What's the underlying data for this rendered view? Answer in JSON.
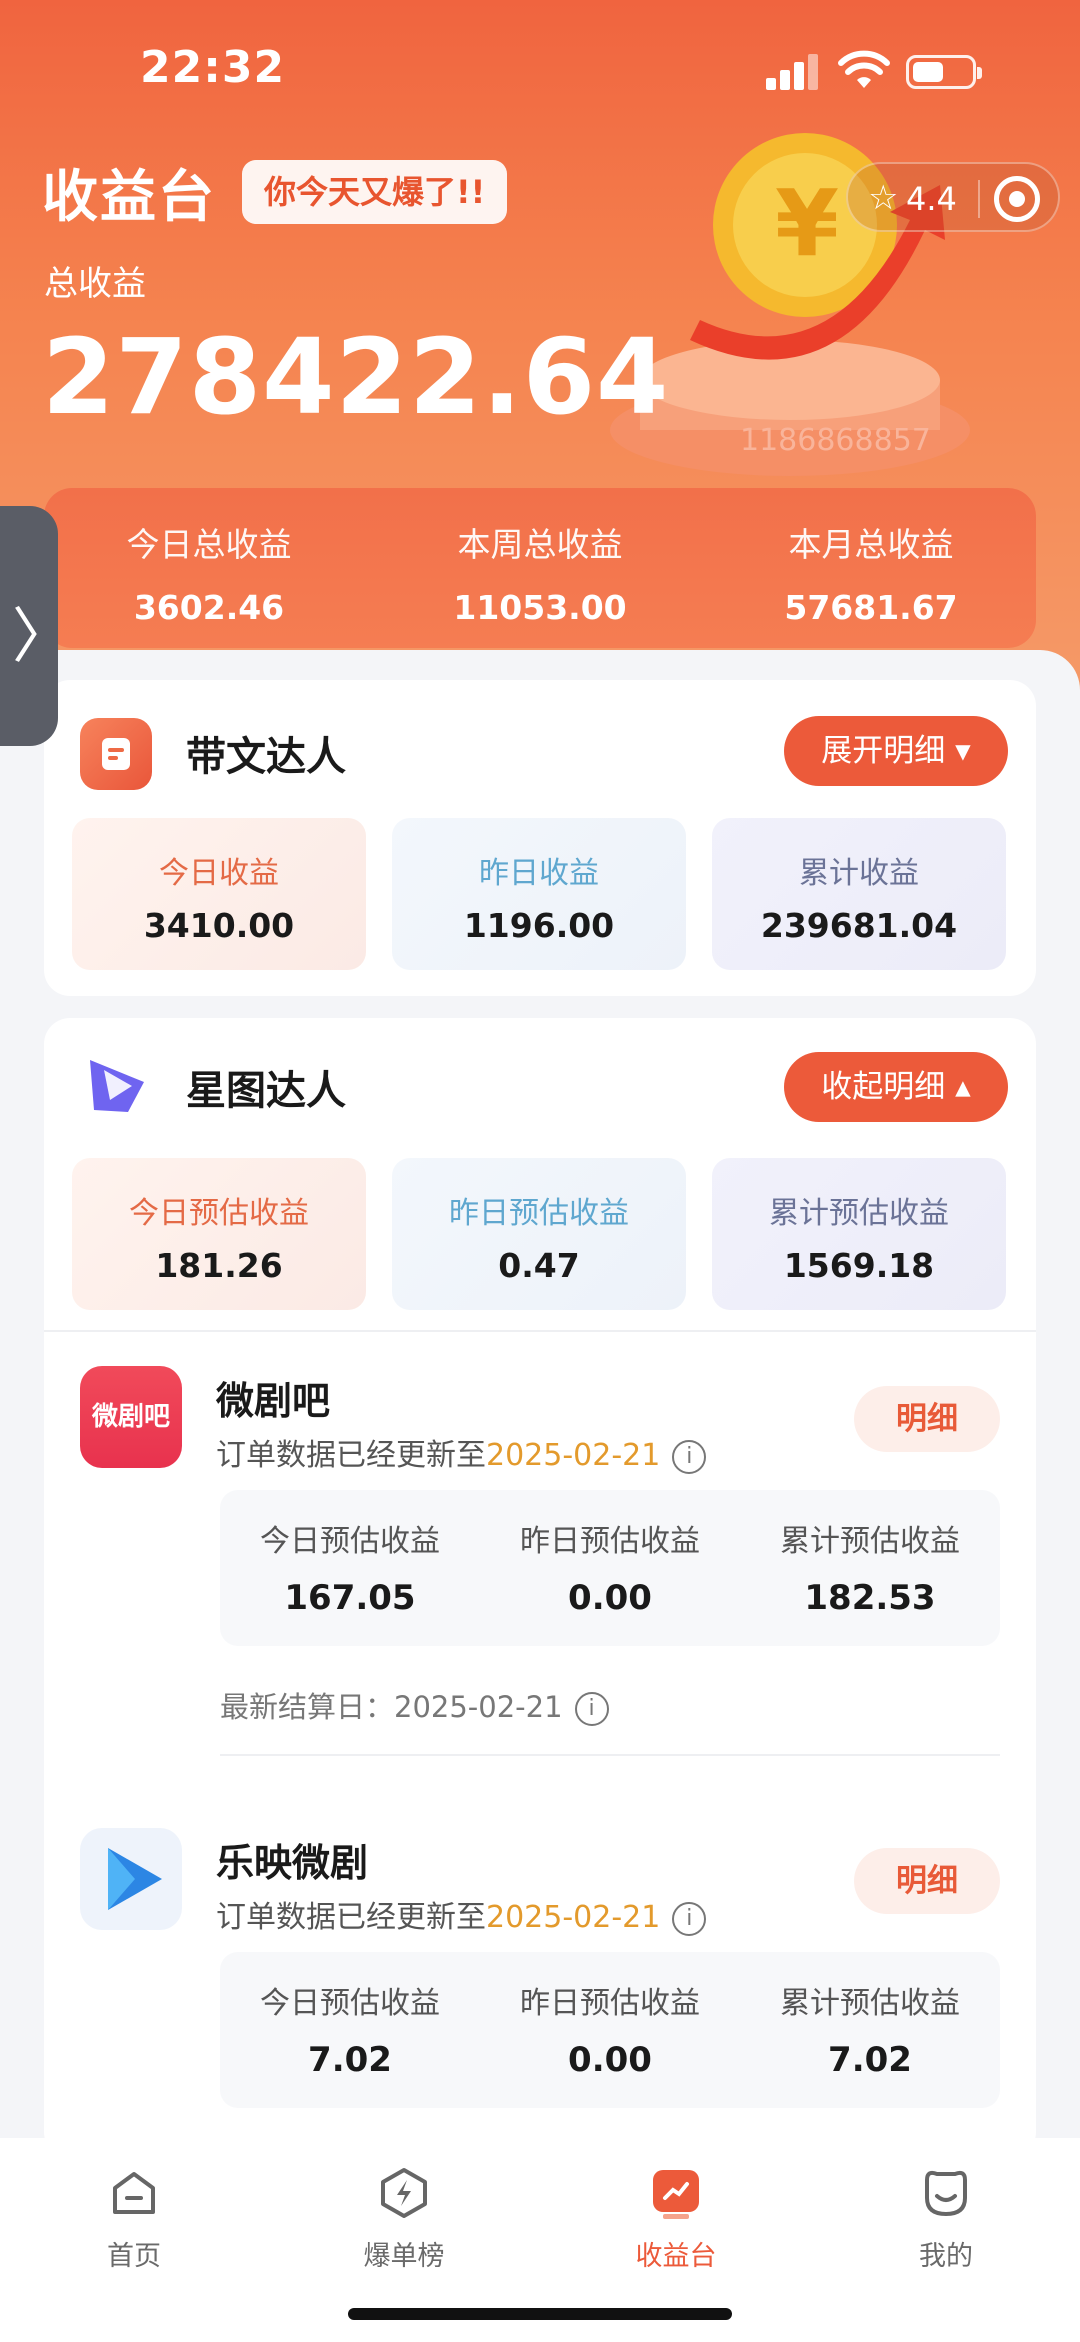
{
  "status_bar": {
    "time": "22:32"
  },
  "header": {
    "title": "收益台",
    "badge": "你今天又爆了!!",
    "rating": "4.4",
    "total_label": "总收益",
    "total_value": "278422.64",
    "coin_text": "1186868857"
  },
  "summary": [
    {
      "label": "今日总收益",
      "value": "3602.46"
    },
    {
      "label": "本周总收益",
      "value": "11053.00"
    },
    {
      "label": "本月总收益",
      "value": "57681.67"
    }
  ],
  "side_handle": {
    "glyph": "〉"
  },
  "card_daiwen": {
    "title": "带文达人",
    "button": "展开明细 ▾",
    "tiles": [
      {
        "label": "今日收益",
        "value": "3410.00"
      },
      {
        "label": "昨日收益",
        "value": "1196.00"
      },
      {
        "label": "累计收益",
        "value": "239681.04"
      }
    ]
  },
  "card_xingtu": {
    "title": "星图达人",
    "button": "收起明细 ▴",
    "tiles": [
      {
        "label": "今日预估收益",
        "value": "181.26"
      },
      {
        "label": "昨日预估收益",
        "value": "0.47"
      },
      {
        "label": "累计预估收益",
        "value": "1569.18"
      }
    ],
    "apps": [
      {
        "name": "微剧吧",
        "logo_text": "微剧吧",
        "sub_prefix": "订单数据已经更新至",
        "sub_date": "2025-02-21",
        "detail": "明细",
        "est": [
          {
            "label": "今日预估收益",
            "value": "167.05"
          },
          {
            "label": "昨日预估收益",
            "value": "0.00"
          },
          {
            "label": "累计预估收益",
            "value": "182.53"
          }
        ],
        "settle": "最新结算日：2025-02-21"
      },
      {
        "name": "乐映微剧",
        "sub_prefix": "订单数据已经更新至",
        "sub_date": "2025-02-21",
        "detail": "明细",
        "est": [
          {
            "label": "今日预估收益",
            "value": "7.02"
          },
          {
            "label": "昨日预估收益",
            "value": "0.00"
          },
          {
            "label": "累计预估收益",
            "value": "7.02"
          }
        ]
      }
    ]
  },
  "tabs": [
    {
      "label": "首页",
      "icon": "home-icon"
    },
    {
      "label": "爆单榜",
      "icon": "lightning-icon"
    },
    {
      "label": "收益台",
      "icon": "earnings-icon",
      "active": true
    },
    {
      "label": "我的",
      "icon": "profile-icon"
    }
  ],
  "colors": {
    "accent": "#ec5a3a",
    "date": "#e39a2c"
  }
}
